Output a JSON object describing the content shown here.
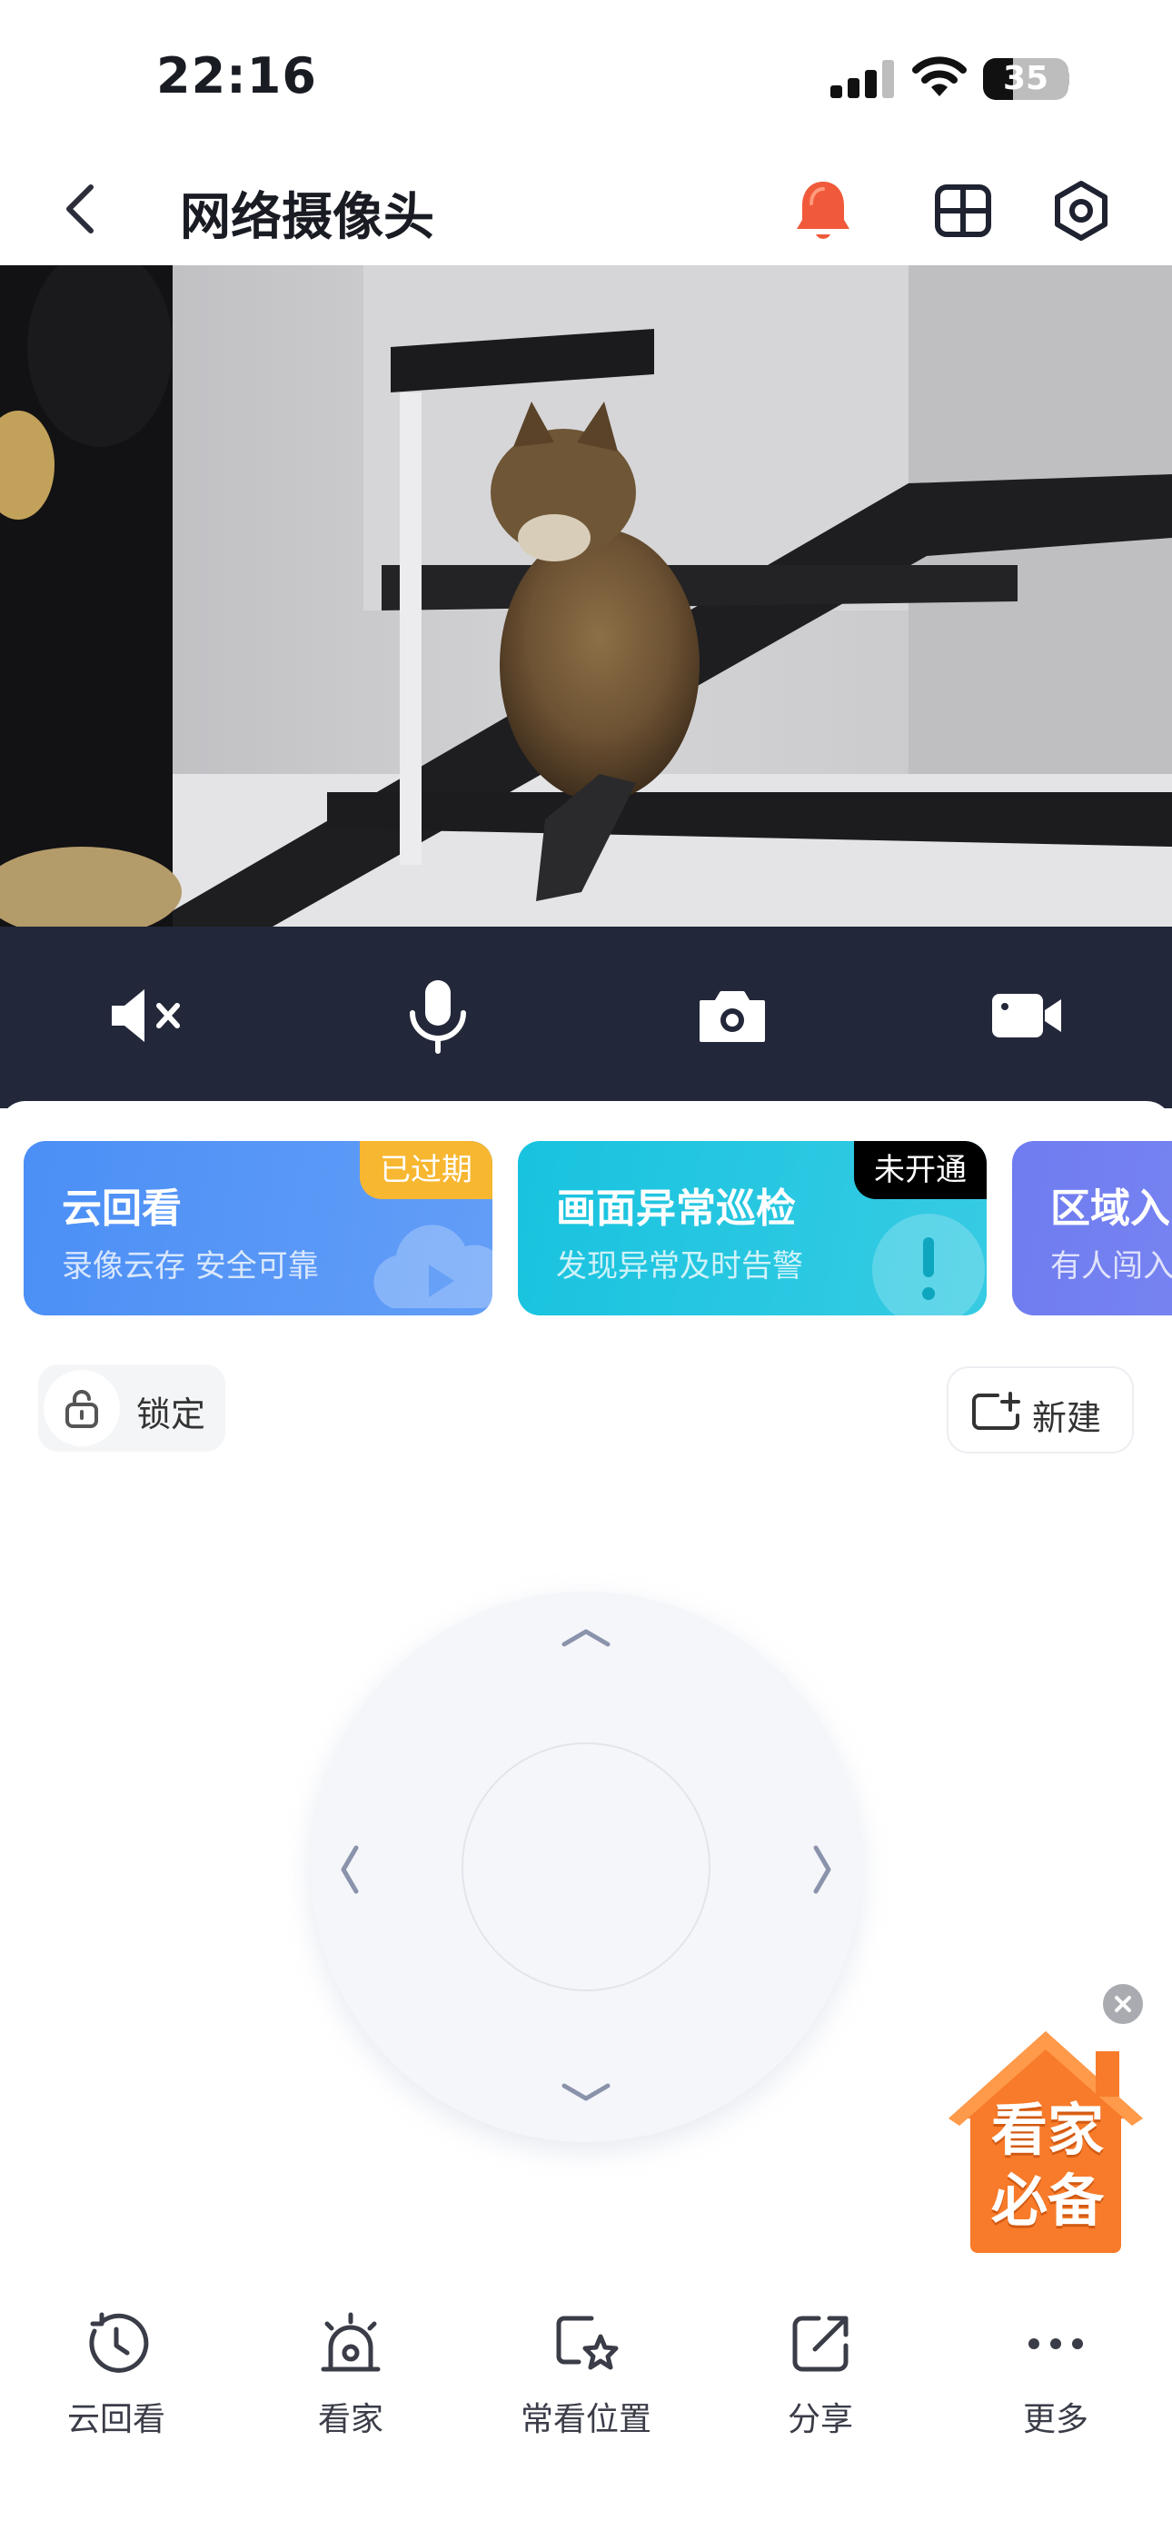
{
  "status_bar": {
    "time": "22:16",
    "battery": "35",
    "battery_level": 0.35
  },
  "header": {
    "title": "网络摄像头",
    "icons": [
      "back-icon",
      "bell-icon",
      "grid-icon",
      "settings-icon"
    ],
    "bell_color": "#f05a3a"
  },
  "controls": {
    "background": "#23273a",
    "items": [
      "mute-icon",
      "microphone-icon",
      "camera-icon",
      "video-record-icon"
    ]
  },
  "service_cards": [
    {
      "title": "云回看",
      "subtitle": "录像云存 安全可靠",
      "badge": "已过期",
      "badge_color": "#f7b731",
      "color": "#4b8ff6"
    },
    {
      "title": "画面异常巡检",
      "subtitle": "发现异常及时告警",
      "badge": "未开通",
      "badge_color": "#000000",
      "color": "#18c3df"
    },
    {
      "title": "区域入",
      "subtitle": "有人闯入",
      "color": "#6f7cf0"
    }
  ],
  "lock": {
    "label": "锁定"
  },
  "new_button": {
    "label": "新建"
  },
  "ptz": {
    "directions": [
      "up",
      "down",
      "left",
      "right"
    ]
  },
  "promo": {
    "text_line1": "看家",
    "text_line2": "必备",
    "color": "#f77b2a"
  },
  "tabbar": {
    "items": [
      {
        "label": "云回看",
        "icon": "clock-replay-icon"
      },
      {
        "label": "看家",
        "icon": "alarm-light-icon"
      },
      {
        "label": "常看位置",
        "icon": "star-bookmark-icon"
      },
      {
        "label": "分享",
        "icon": "share-icon"
      },
      {
        "label": "更多",
        "icon": "more-dots-icon"
      }
    ]
  }
}
